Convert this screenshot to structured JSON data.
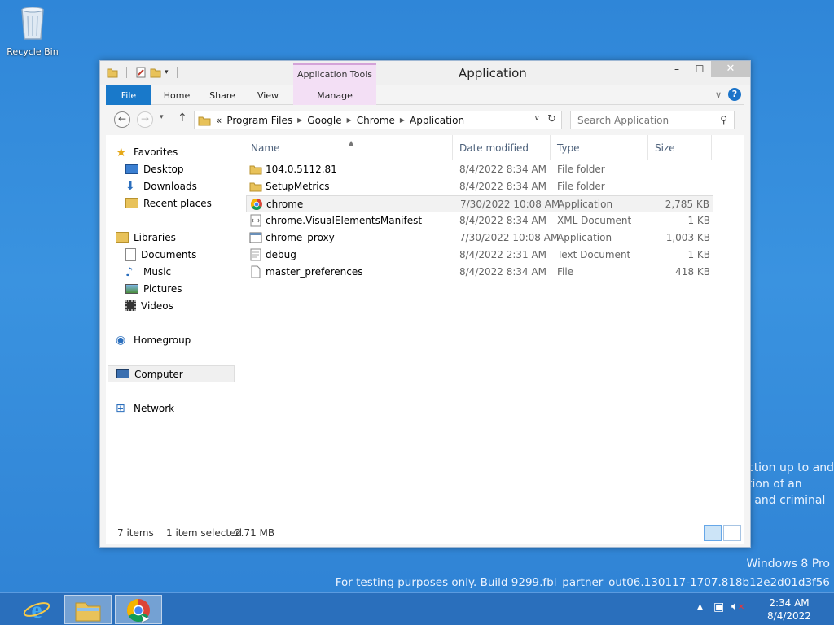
{
  "desktop": {
    "recycle_bin_label": "Recycle Bin",
    "watermark_lines": [
      "ction up to and",
      "tion of an",
      "l and criminal"
    ],
    "os_name": "Windows 8 Pro",
    "build_text": "For testing purposes only. Build 9299.fbl_partner_out06.130117-1707.818b12e2d01d3f56"
  },
  "window": {
    "title": "Application",
    "context_tab_label": "Application Tools",
    "controls": {
      "minimize": "–",
      "maximize": "☐",
      "close": "✕"
    }
  },
  "ribbon": {
    "tabs": [
      {
        "label": "File"
      },
      {
        "label": "Home"
      },
      {
        "label": "Share"
      },
      {
        "label": "View"
      },
      {
        "label": "Manage"
      }
    ]
  },
  "address_bar": {
    "prefix": "«",
    "crumbs": [
      "Program Files",
      "Google",
      "Chrome",
      "Application"
    ],
    "search_placeholder": "Search Application"
  },
  "nav_pane": {
    "items": [
      {
        "label": "Favorites"
      },
      {
        "label": "Desktop"
      },
      {
        "label": "Downloads"
      },
      {
        "label": "Recent places"
      },
      {
        "label": "Libraries"
      },
      {
        "label": "Documents"
      },
      {
        "label": "Music"
      },
      {
        "label": "Pictures"
      },
      {
        "label": "Videos"
      },
      {
        "label": "Homegroup"
      },
      {
        "label": "Computer"
      },
      {
        "label": "Network"
      }
    ]
  },
  "file_list": {
    "columns": [
      "Name",
      "Date modified",
      "Type",
      "Size"
    ],
    "rows": [
      {
        "name": "104.0.5112.81",
        "date": "8/4/2022 8:34 AM",
        "type": "File folder",
        "size": "",
        "icon": "folder-icon"
      },
      {
        "name": "SetupMetrics",
        "date": "8/4/2022 8:34 AM",
        "type": "File folder",
        "size": "",
        "icon": "folder-icon"
      },
      {
        "name": "chrome",
        "date": "7/30/2022 10:08 AM",
        "type": "Application",
        "size": "2,785 KB",
        "icon": "chrome-icon"
      },
      {
        "name": "chrome.VisualElementsManifest",
        "date": "8/4/2022 8:34 AM",
        "type": "XML Document",
        "size": "1 KB",
        "icon": "xml-file-icon"
      },
      {
        "name": "chrome_proxy",
        "date": "7/30/2022 10:08 AM",
        "type": "Application",
        "size": "1,003 KB",
        "icon": "app-icon"
      },
      {
        "name": "debug",
        "date": "8/4/2022 2:31 AM",
        "type": "Text Document",
        "size": "1 KB",
        "icon": "text-file-icon"
      },
      {
        "name": "master_preferences",
        "date": "8/4/2022 8:34 AM",
        "type": "File",
        "size": "418 KB",
        "icon": "file-icon"
      }
    ]
  },
  "status_bar": {
    "item_count": "7 items",
    "selection": "1 item selected",
    "selection_size": "2.71 MB"
  },
  "taskbar": {
    "clock_time": "2:34 AM",
    "clock_date": "8/4/2022"
  }
}
